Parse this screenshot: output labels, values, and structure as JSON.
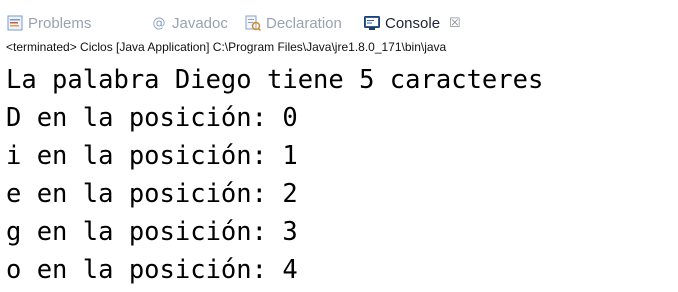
{
  "tabs": [
    {
      "label": "Problems",
      "icon": "problems-icon",
      "active": false
    },
    {
      "label": "Javadoc",
      "icon": "javadoc-icon",
      "active": false
    },
    {
      "label": "Declaration",
      "icon": "declaration-icon",
      "active": false
    },
    {
      "label": "Console",
      "icon": "console-icon",
      "active": true,
      "close_glyph": "☒"
    }
  ],
  "status": {
    "text": "<terminated> Ciclos [Java Application] C:\\Program Files\\Java\\jre1.8.0_171\\bin\\java"
  },
  "console": {
    "lines": [
      "La palabra Diego tiene 5 caracteres",
      "D en la posición: 0",
      "i en la posición: 1",
      "e en la posición: 2",
      "g en la posición: 3",
      "o en la posición: 4"
    ]
  },
  "colors": {
    "inactive_tab_text": "#9aa2b0",
    "active_tab_text": "#1f2430",
    "console_text": "#000000",
    "background": "#ffffff"
  }
}
